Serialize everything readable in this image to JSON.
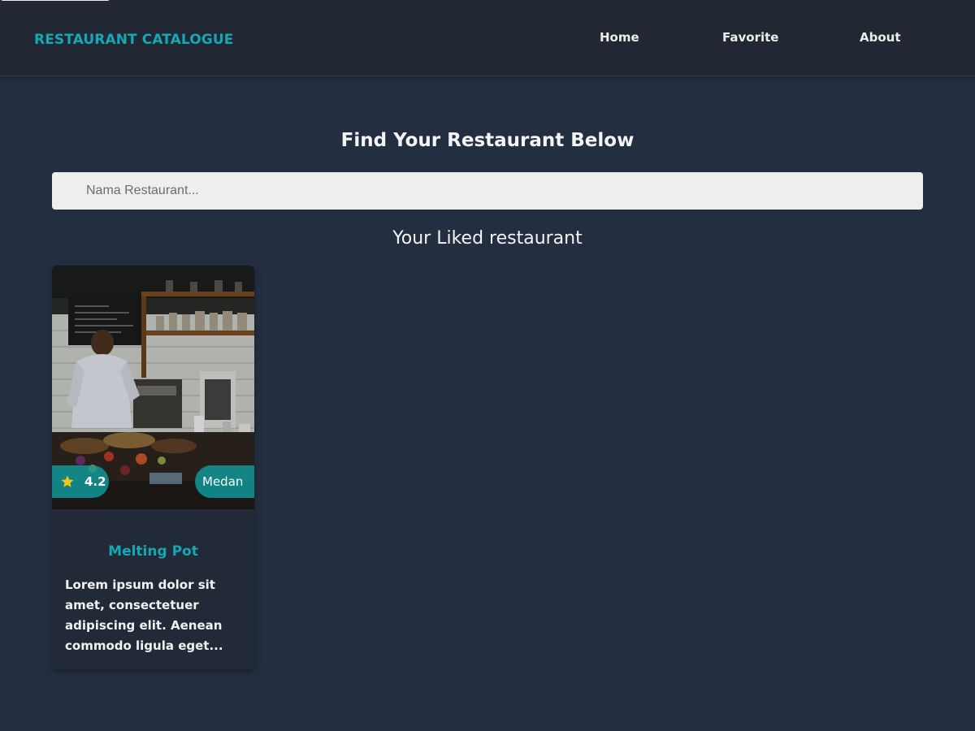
{
  "header": {
    "brand": "RESTAURANT CATALOGUE",
    "nav": [
      {
        "label": "Home"
      },
      {
        "label": "Favorite"
      },
      {
        "label": "About"
      }
    ]
  },
  "main": {
    "headline": "Find Your Restaurant Below",
    "search": {
      "placeholder": "Nama Restaurant...",
      "value": ""
    },
    "section_title": "Your Liked restaurant"
  },
  "restaurants": [
    {
      "name": "Melting Pot",
      "rating": "4.2",
      "city": "Medan",
      "description": "Lorem ipsum dolor sit amet, consectetuer adipiscing elit. Aenean commodo ligula eget...",
      "rating_icon": "star-icon",
      "image": "restaurant-kitchen-photo"
    }
  ],
  "colors": {
    "page_bg": "#232f40",
    "header_bg": "#222833",
    "accent": "#14a8b4",
    "badge": "#129698",
    "star": "#f5c518"
  }
}
